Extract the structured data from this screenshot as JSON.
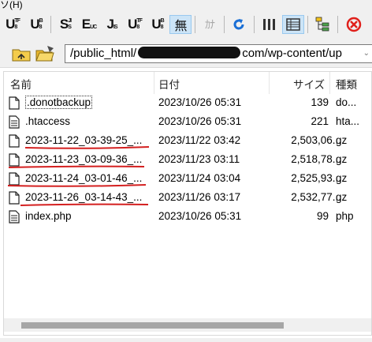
{
  "menu": {
    "partial_label": "ソ(H)"
  },
  "toolbar": {
    "buttons": [
      {
        "name": "utf8-n-upload-button",
        "glyph": "U",
        "sup": "8",
        "sub": "F"
      },
      {
        "name": "utf8-bom-upload-button",
        "glyph": "U",
        "sup": "8",
        "sub": "B"
      },
      {
        "name": "sjis-button",
        "glyph": "S",
        "sup": "J",
        "sub": "IS"
      },
      {
        "name": "euc-button",
        "glyph": "E",
        "sub": "UC"
      },
      {
        "name": "jis-button",
        "glyph": "J",
        "sub": "IS"
      },
      {
        "name": "utf8-n-download-button",
        "glyph": "U",
        "sup": "8",
        "sub": "F"
      },
      {
        "name": "utf8-bom-download-button",
        "glyph": "U",
        "sup": "8",
        "sub": "B"
      },
      {
        "name": "no-conversion-button",
        "glyph": "無"
      },
      {
        "name": "kana-convert-button",
        "glyph": "ｶﾅ"
      },
      {
        "name": "refresh-button",
        "glyph": "↺"
      },
      {
        "name": "list-view-button",
        "glyph": "▥"
      },
      {
        "name": "detail-view-button",
        "glyph": "▦"
      },
      {
        "name": "tree-view-button",
        "glyph": "⊞"
      },
      {
        "name": "stop-button",
        "glyph": "⊗"
      }
    ],
    "accent_active": "#cce4f7",
    "refresh_color": "#1a6fd6",
    "stop_color": "#e0201b"
  },
  "pathbar": {
    "path_prefix": "/public_html/",
    "path_suffix": "com/wp-content/up"
  },
  "list": {
    "headers": {
      "name": "名前",
      "date": "日付",
      "size": "サイズ",
      "type": "種類"
    },
    "files": [
      {
        "name": ".donotbackup",
        "date": "2023/10/26 05:31",
        "size": "139",
        "type": "do...",
        "icon": "blank-file-icon"
      },
      {
        "name": ".htaccess",
        "date": "2023/10/26 05:31",
        "size": "221",
        "type": "hta...",
        "icon": "text-file-icon"
      },
      {
        "name": "2023-11-22_03-39-25_...",
        "date": "2023/11/22 03:42",
        "size": "2,503,06...",
        "type": "gz",
        "icon": "blank-file-icon"
      },
      {
        "name": "2023-11-23_03-09-36_...",
        "date": "2023/11/23 03:11",
        "size": "2,518,78...",
        "type": "gz",
        "icon": "blank-file-icon"
      },
      {
        "name": "2023-11-24_03-01-46_...",
        "date": "2023/11/24 03:04",
        "size": "2,525,93...",
        "type": "gz",
        "icon": "blank-file-icon"
      },
      {
        "name": "2023-11-26_03-14-43_...",
        "date": "2023/11/26 03:17",
        "size": "2,532,77...",
        "type": "gz",
        "icon": "blank-file-icon"
      },
      {
        "name": "index.php",
        "date": "2023/10/26 05:31",
        "size": "99",
        "type": "php",
        "icon": "text-file-icon"
      }
    ],
    "annotation_color": "#d42020"
  }
}
